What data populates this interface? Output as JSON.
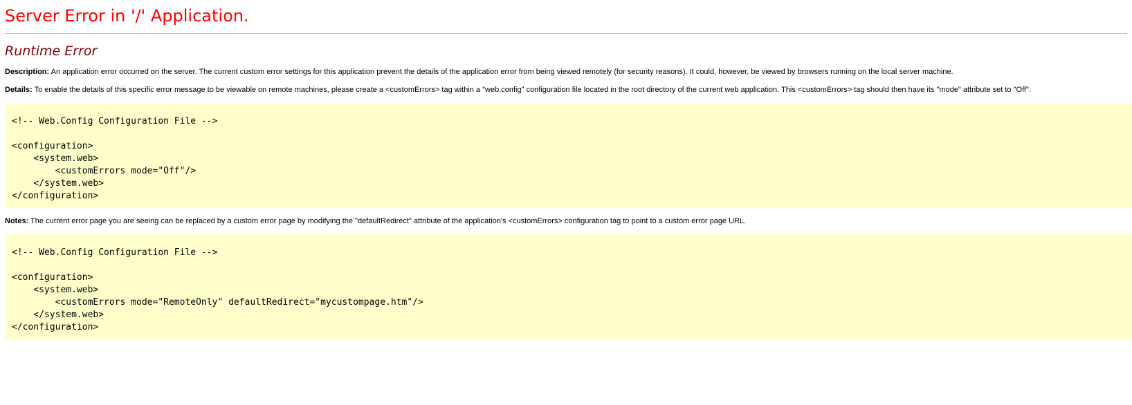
{
  "page": {
    "title": "Server Error in '/' Application.",
    "subtitle": "Runtime Error",
    "colors": {
      "title": "#ff0000",
      "subtitle": "#800000",
      "code_background": "#ffffcc"
    }
  },
  "description": {
    "label": "Description:",
    "text": " An application error occurred on the server. The current custom error settings for this application prevent the details of the application error from being viewed remotely (for security reasons). It could, however, be viewed by browsers running on the local server machine."
  },
  "details": {
    "label": "Details:",
    "text": " To enable the details of this specific error message to be viewable on remote machines, please create a <customErrors> tag within a \"web.config\" configuration file located in the root directory of the current web application. This <customErrors> tag should then have its \"mode\" attribute set to \"Off\"."
  },
  "code_sample_1": "<!-- Web.Config Configuration File -->\n\n<configuration>\n    <system.web>\n        <customErrors mode=\"Off\"/>\n    </system.web>\n</configuration>",
  "notes": {
    "label": "Notes:",
    "text": " The current error page you are seeing can be replaced by a custom error page by modifying the \"defaultRedirect\" attribute of the application's <customErrors> configuration tag to point to a custom error page URL."
  },
  "code_sample_2": "<!-- Web.Config Configuration File -->\n\n<configuration>\n    <system.web>\n        <customErrors mode=\"RemoteOnly\" defaultRedirect=\"mycustompage.htm\"/>\n    </system.web>\n</configuration>"
}
